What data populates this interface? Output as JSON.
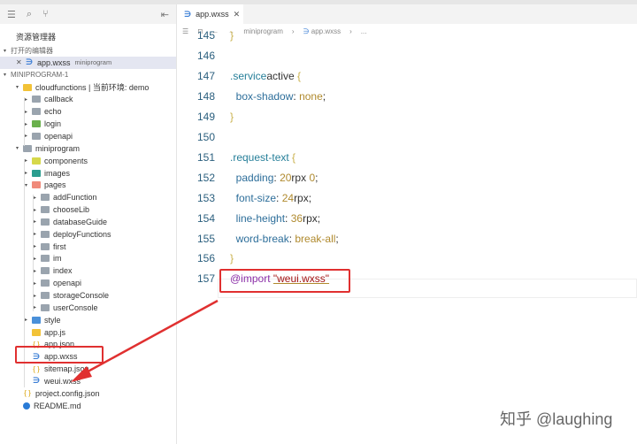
{
  "sidebar": {
    "title": "资源管理器",
    "rows": [
      {
        "label": "打开的编辑器",
        "kind": "section",
        "depth": 0,
        "arrow": "▾"
      },
      {
        "label": "app.wxss",
        "sub": "miniprogram",
        "kind": "css",
        "depth": 1,
        "close": "✕",
        "selected": true
      },
      {
        "label": "MINIPROGRAM-1",
        "kind": "section",
        "depth": 0,
        "arrow": "▾"
      },
      {
        "label": "cloudfunctions | 当前环境: demo",
        "kind": "cloud",
        "depth": 1,
        "arrow": "▾"
      },
      {
        "label": "callback",
        "kind": "folder",
        "depth": 2,
        "arrow": "▸"
      },
      {
        "label": "echo",
        "kind": "folder",
        "depth": 2,
        "arrow": "▸"
      },
      {
        "label": "login",
        "kind": "login",
        "depth": 2,
        "arrow": "▸"
      },
      {
        "label": "openapi",
        "kind": "folder",
        "depth": 2,
        "arrow": "▸"
      },
      {
        "label": "miniprogram",
        "kind": "folder",
        "depth": 1,
        "arrow": "▾"
      },
      {
        "label": "components",
        "kind": "comp",
        "depth": 2,
        "arrow": "▸"
      },
      {
        "label": "images",
        "kind": "img",
        "depth": 2,
        "arrow": "▸"
      },
      {
        "label": "pages",
        "kind": "pages",
        "depth": 2,
        "arrow": "▾"
      },
      {
        "label": "addFunction",
        "kind": "folder",
        "depth": 3,
        "arrow": "▸"
      },
      {
        "label": "chooseLib",
        "kind": "folder",
        "depth": 3,
        "arrow": "▸"
      },
      {
        "label": "databaseGuide",
        "kind": "folder",
        "depth": 3,
        "arrow": "▸"
      },
      {
        "label": "deployFunctions",
        "kind": "folder",
        "depth": 3,
        "arrow": "▸"
      },
      {
        "label": "first",
        "kind": "folder",
        "depth": 3,
        "arrow": "▸"
      },
      {
        "label": "im",
        "kind": "folder",
        "depth": 3,
        "arrow": "▸"
      },
      {
        "label": "index",
        "kind": "folder",
        "depth": 3,
        "arrow": "▸"
      },
      {
        "label": "openapi",
        "kind": "folder",
        "depth": 3,
        "arrow": "▸"
      },
      {
        "label": "storageConsole",
        "kind": "folder",
        "depth": 3,
        "arrow": "▸"
      },
      {
        "label": "userConsole",
        "kind": "folder",
        "depth": 3,
        "arrow": "▸"
      },
      {
        "label": "style",
        "kind": "style",
        "depth": 2,
        "arrow": "▸"
      },
      {
        "label": "app.js",
        "kind": "js",
        "depth": 2
      },
      {
        "label": "app.json",
        "kind": "json",
        "depth": 2
      },
      {
        "label": "app.wxss",
        "kind": "css",
        "depth": 2
      },
      {
        "label": "sitemap.json",
        "kind": "json",
        "depth": 2
      },
      {
        "label": "weui.wxss",
        "kind": "css",
        "depth": 2
      },
      {
        "label": "project.config.json",
        "kind": "json",
        "depth": 1
      },
      {
        "label": "README.md",
        "kind": "info",
        "depth": 1
      }
    ]
  },
  "editor": {
    "tab_label": "app.wxss",
    "tab_close": "✕",
    "breadcrumb": [
      "miniprogram",
      "app.wxss",
      "..."
    ],
    "lines": [
      {
        "n": "145",
        "t": [
          [
            "brace",
            "}"
          ]
        ]
      },
      {
        "n": "146",
        "t": []
      },
      {
        "n": "147",
        "t": [
          [
            "sel-c",
            ".service"
          ],
          [
            "",
            "active "
          ],
          [
            "brace",
            "{"
          ]
        ]
      },
      {
        "n": "148",
        "t": [
          [
            "",
            "  "
          ],
          [
            "prop",
            "box-shadow"
          ],
          [
            "",
            ": "
          ],
          [
            "num",
            "none"
          ],
          [
            "",
            ";"
          ]
        ]
      },
      {
        "n": "149",
        "t": [
          [
            "brace",
            "}"
          ]
        ]
      },
      {
        "n": "150",
        "t": []
      },
      {
        "n": "151",
        "t": [
          [
            "sel-c",
            ".request-text "
          ],
          [
            "brace",
            "{"
          ]
        ]
      },
      {
        "n": "152",
        "t": [
          [
            "",
            "  "
          ],
          [
            "prop",
            "padding"
          ],
          [
            "",
            ": "
          ],
          [
            "num",
            "20"
          ],
          [
            "",
            "rpx "
          ],
          [
            "num",
            "0"
          ],
          [
            "",
            ";"
          ]
        ]
      },
      {
        "n": "153",
        "t": [
          [
            "",
            "  "
          ],
          [
            "prop",
            "font-size"
          ],
          [
            "",
            ": "
          ],
          [
            "num",
            "24"
          ],
          [
            "",
            "rpx;"
          ]
        ]
      },
      {
        "n": "154",
        "t": [
          [
            "",
            "  "
          ],
          [
            "prop",
            "line-height"
          ],
          [
            "",
            ": "
          ],
          [
            "num",
            "36"
          ],
          [
            "",
            "rpx;"
          ]
        ]
      },
      {
        "n": "155",
        "t": [
          [
            "",
            "  "
          ],
          [
            "prop",
            "word-break"
          ],
          [
            "",
            ": "
          ],
          [
            "num",
            "break-all"
          ],
          [
            "",
            ";"
          ]
        ]
      },
      {
        "n": "156",
        "t": [
          [
            "brace",
            "}"
          ]
        ]
      },
      {
        "n": "157",
        "t": [
          [
            "at",
            "@import "
          ],
          [
            "str",
            "\"weui.wxss\""
          ]
        ]
      }
    ]
  },
  "watermark": "知乎 @laughing",
  "colors": {
    "highlight": "#e03030"
  }
}
